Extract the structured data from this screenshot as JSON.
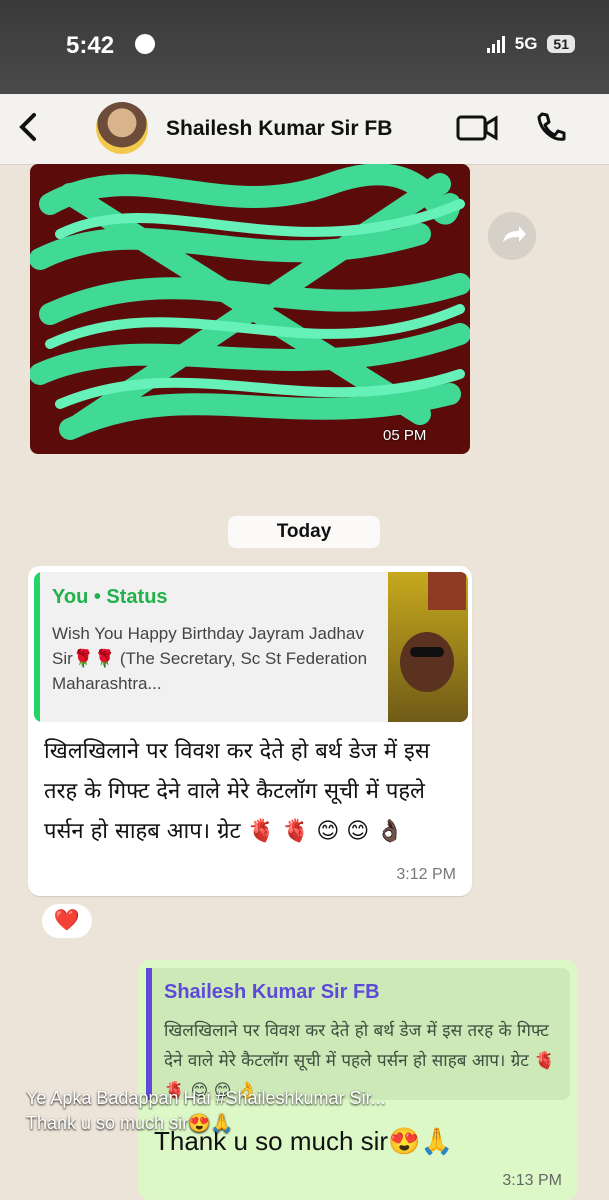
{
  "device": {
    "time": "5:42",
    "network": "5G",
    "battery": "51"
  },
  "chat": {
    "title": "Shailesh Kumar Sir FB",
    "today_label": "Today",
    "image_time": "05 PM"
  },
  "incoming": {
    "quote_author": "You • Status",
    "quote_text": "Wish You Happy Birthday Jayram Jadhav Sir🌹🌹 (The Secretary, Sc St Federation Maharashtra...",
    "message": "खिलखिलाने पर विवश कर देते हो बर्थ डेज में इस तरह के गिफ्ट देने वाले मेरे कैटलॉग सूची में पहले पर्सन हो साहब आप। ग्रेट 🫀 🫀 😊 😊 👌🏿",
    "time": "3:12 PM",
    "reaction": "❤️"
  },
  "outgoing": {
    "quote_author": "Shailesh Kumar Sir FB",
    "quote_text": "खिलखिलाने पर विवश कर देते हो बर्थ डेज में इस तरह के गिफ्ट देने वाले मेरे कैटलॉग सूची में पहले पर्सन हो साहब आप। ग्रेट 🫀 🫀 😊 😊 👌",
    "message": "Thank u so much sir😍🙏",
    "time": "3:13 PM"
  },
  "caption": {
    "line1": "Ye Apka Badappan Hai #Shaileshkumar Sir...",
    "line2": "Thank u so much sir😍🙏"
  },
  "colors": {
    "status_green": "#22b14c",
    "reply_purple": "#5e4ad9",
    "outgoing_bubble": "#dcf8c6"
  }
}
